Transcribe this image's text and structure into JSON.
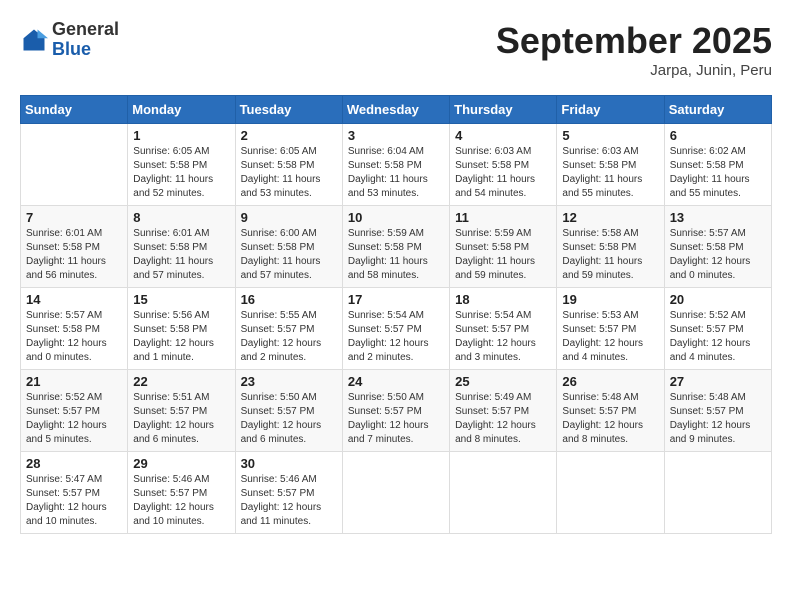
{
  "header": {
    "logo": {
      "general": "General",
      "blue": "Blue"
    },
    "title": "September 2025",
    "location": "Jarpa, Junin, Peru"
  },
  "calendar": {
    "days_of_week": [
      "Sunday",
      "Monday",
      "Tuesday",
      "Wednesday",
      "Thursday",
      "Friday",
      "Saturday"
    ],
    "weeks": [
      [
        {
          "day": "",
          "info": ""
        },
        {
          "day": "1",
          "info": "Sunrise: 6:05 AM\nSunset: 5:58 PM\nDaylight: 11 hours\nand 52 minutes."
        },
        {
          "day": "2",
          "info": "Sunrise: 6:05 AM\nSunset: 5:58 PM\nDaylight: 11 hours\nand 53 minutes."
        },
        {
          "day": "3",
          "info": "Sunrise: 6:04 AM\nSunset: 5:58 PM\nDaylight: 11 hours\nand 53 minutes."
        },
        {
          "day": "4",
          "info": "Sunrise: 6:03 AM\nSunset: 5:58 PM\nDaylight: 11 hours\nand 54 minutes."
        },
        {
          "day": "5",
          "info": "Sunrise: 6:03 AM\nSunset: 5:58 PM\nDaylight: 11 hours\nand 55 minutes."
        },
        {
          "day": "6",
          "info": "Sunrise: 6:02 AM\nSunset: 5:58 PM\nDaylight: 11 hours\nand 55 minutes."
        }
      ],
      [
        {
          "day": "7",
          "info": "Sunrise: 6:01 AM\nSunset: 5:58 PM\nDaylight: 11 hours\nand 56 minutes."
        },
        {
          "day": "8",
          "info": "Sunrise: 6:01 AM\nSunset: 5:58 PM\nDaylight: 11 hours\nand 57 minutes."
        },
        {
          "day": "9",
          "info": "Sunrise: 6:00 AM\nSunset: 5:58 PM\nDaylight: 11 hours\nand 57 minutes."
        },
        {
          "day": "10",
          "info": "Sunrise: 5:59 AM\nSunset: 5:58 PM\nDaylight: 11 hours\nand 58 minutes."
        },
        {
          "day": "11",
          "info": "Sunrise: 5:59 AM\nSunset: 5:58 PM\nDaylight: 11 hours\nand 59 minutes."
        },
        {
          "day": "12",
          "info": "Sunrise: 5:58 AM\nSunset: 5:58 PM\nDaylight: 11 hours\nand 59 minutes."
        },
        {
          "day": "13",
          "info": "Sunrise: 5:57 AM\nSunset: 5:58 PM\nDaylight: 12 hours\nand 0 minutes."
        }
      ],
      [
        {
          "day": "14",
          "info": "Sunrise: 5:57 AM\nSunset: 5:58 PM\nDaylight: 12 hours\nand 0 minutes."
        },
        {
          "day": "15",
          "info": "Sunrise: 5:56 AM\nSunset: 5:58 PM\nDaylight: 12 hours\nand 1 minute."
        },
        {
          "day": "16",
          "info": "Sunrise: 5:55 AM\nSunset: 5:57 PM\nDaylight: 12 hours\nand 2 minutes."
        },
        {
          "day": "17",
          "info": "Sunrise: 5:54 AM\nSunset: 5:57 PM\nDaylight: 12 hours\nand 2 minutes."
        },
        {
          "day": "18",
          "info": "Sunrise: 5:54 AM\nSunset: 5:57 PM\nDaylight: 12 hours\nand 3 minutes."
        },
        {
          "day": "19",
          "info": "Sunrise: 5:53 AM\nSunset: 5:57 PM\nDaylight: 12 hours\nand 4 minutes."
        },
        {
          "day": "20",
          "info": "Sunrise: 5:52 AM\nSunset: 5:57 PM\nDaylight: 12 hours\nand 4 minutes."
        }
      ],
      [
        {
          "day": "21",
          "info": "Sunrise: 5:52 AM\nSunset: 5:57 PM\nDaylight: 12 hours\nand 5 minutes."
        },
        {
          "day": "22",
          "info": "Sunrise: 5:51 AM\nSunset: 5:57 PM\nDaylight: 12 hours\nand 6 minutes."
        },
        {
          "day": "23",
          "info": "Sunrise: 5:50 AM\nSunset: 5:57 PM\nDaylight: 12 hours\nand 6 minutes."
        },
        {
          "day": "24",
          "info": "Sunrise: 5:50 AM\nSunset: 5:57 PM\nDaylight: 12 hours\nand 7 minutes."
        },
        {
          "day": "25",
          "info": "Sunrise: 5:49 AM\nSunset: 5:57 PM\nDaylight: 12 hours\nand 8 minutes."
        },
        {
          "day": "26",
          "info": "Sunrise: 5:48 AM\nSunset: 5:57 PM\nDaylight: 12 hours\nand 8 minutes."
        },
        {
          "day": "27",
          "info": "Sunrise: 5:48 AM\nSunset: 5:57 PM\nDaylight: 12 hours\nand 9 minutes."
        }
      ],
      [
        {
          "day": "28",
          "info": "Sunrise: 5:47 AM\nSunset: 5:57 PM\nDaylight: 12 hours\nand 10 minutes."
        },
        {
          "day": "29",
          "info": "Sunrise: 5:46 AM\nSunset: 5:57 PM\nDaylight: 12 hours\nand 10 minutes."
        },
        {
          "day": "30",
          "info": "Sunrise: 5:46 AM\nSunset: 5:57 PM\nDaylight: 12 hours\nand 11 minutes."
        },
        {
          "day": "",
          "info": ""
        },
        {
          "day": "",
          "info": ""
        },
        {
          "day": "",
          "info": ""
        },
        {
          "day": "",
          "info": ""
        }
      ]
    ]
  }
}
